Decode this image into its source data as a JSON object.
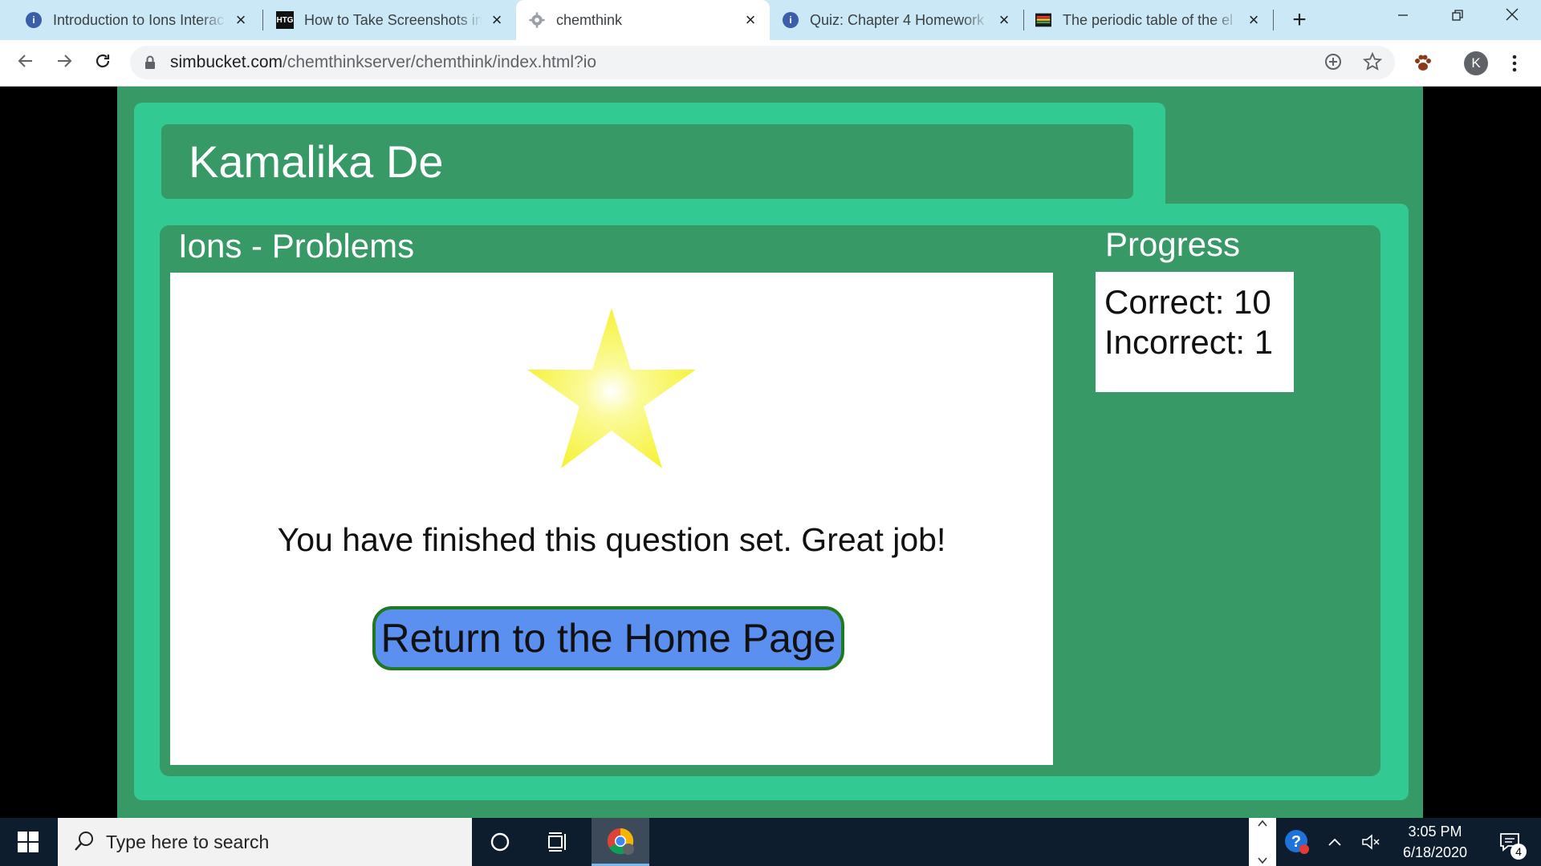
{
  "browser": {
    "tabs": [
      {
        "title": "Introduction to Ions Interac",
        "icon": "circle-i-icon"
      },
      {
        "title": "How to Take Screenshots in",
        "icon": "htg-icon"
      },
      {
        "title": "chemthink",
        "icon": "gear-icon"
      },
      {
        "title": "Quiz: Chapter 4 Homework",
        "icon": "circle-i-icon"
      },
      {
        "title": "The periodic table of the el",
        "icon": "periodic-table-icon"
      }
    ],
    "htg_icon_text": "HTG",
    "circle_icon_text": "i",
    "url_host": "simbucket.com",
    "url_path": "/chemthinkserver/chemthink/index.html?io",
    "avatar_letter": "K"
  },
  "app": {
    "user_name": "Kamalika De",
    "section_title": "Ions - Problems",
    "finished_message": "You have finished this question set.  Great job!",
    "home_button_label": "Return to the Home Page",
    "progress_title": "Progress",
    "correct_line": "Correct: 10",
    "incorrect_line": "Incorrect: 1",
    "star_color": "#f5f232"
  },
  "taskbar": {
    "search_placeholder": "Type here to search",
    "time": "3:05 PM",
    "date": "6/18/2020",
    "notification_count": "4"
  },
  "colors": {
    "panel_dark": "#369966",
    "panel_light": "#32c992",
    "button_fill": "#5b8ff0",
    "button_border": "#1f7a1f"
  }
}
